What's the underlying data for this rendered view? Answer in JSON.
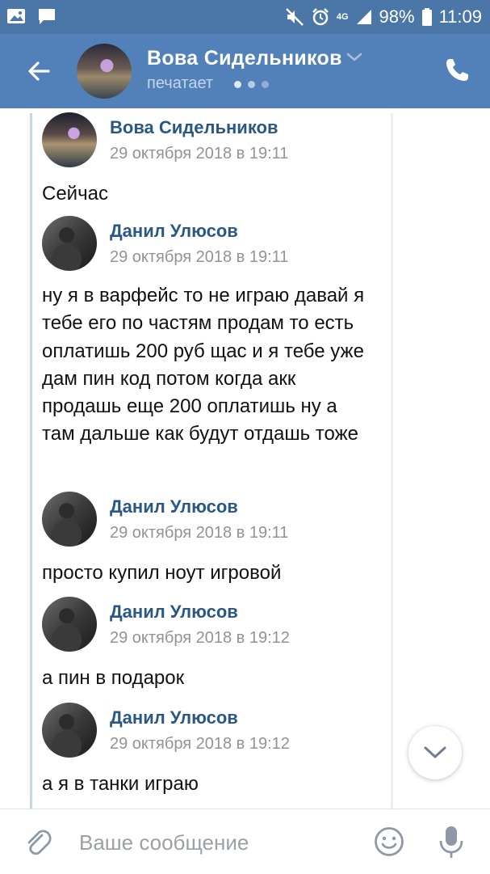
{
  "status_bar": {
    "battery": "98%",
    "time": "11:09",
    "network": "4G",
    "icons": [
      "gallery-icon",
      "message-icon",
      "mute-icon",
      "alarm-icon",
      "signal-icon",
      "battery-icon"
    ]
  },
  "header": {
    "name": "Вова Сидельников",
    "status": "печатает",
    "icons": [
      "back-arrow-icon",
      "chevron-down-icon",
      "phone-icon"
    ]
  },
  "messages": [
    {
      "author": "Вова Сидельников",
      "time": "29 октября 2018 в 19:11",
      "text": "Сейчас"
    },
    {
      "author": "Данил Улюсов",
      "time": "29 октября 2018 в 19:11",
      "text": "ну я в варфейс то не играю давай я тебе его по частям продам то есть оплатишь 200 руб щас и я тебе уже дам пин код потом когда акк продашь еще 200 оплатишь ну а там дальше как будут отдашь тоже"
    },
    {
      "author": "Данил Улюсов",
      "time": "29 октября 2018 в 19:11",
      "text": "просто купил ноут игровой"
    },
    {
      "author": "Данил Улюсов",
      "time": "29 октября 2018 в 19:12",
      "text": "а пин в подарок"
    },
    {
      "author": "Данил Улюсов",
      "time": "29 октября 2018 в 19:12",
      "text": "а я в танки играю"
    }
  ],
  "composer": {
    "placeholder": "Ваше сообщение",
    "icons": [
      "paperclip-icon",
      "sticker-icon",
      "microphone-icon"
    ]
  },
  "colors": {
    "header_bg": "#5181b8",
    "status_bar_bg": "#4a76a8",
    "author_name": "#2a5885",
    "timestamp": "#939393"
  }
}
